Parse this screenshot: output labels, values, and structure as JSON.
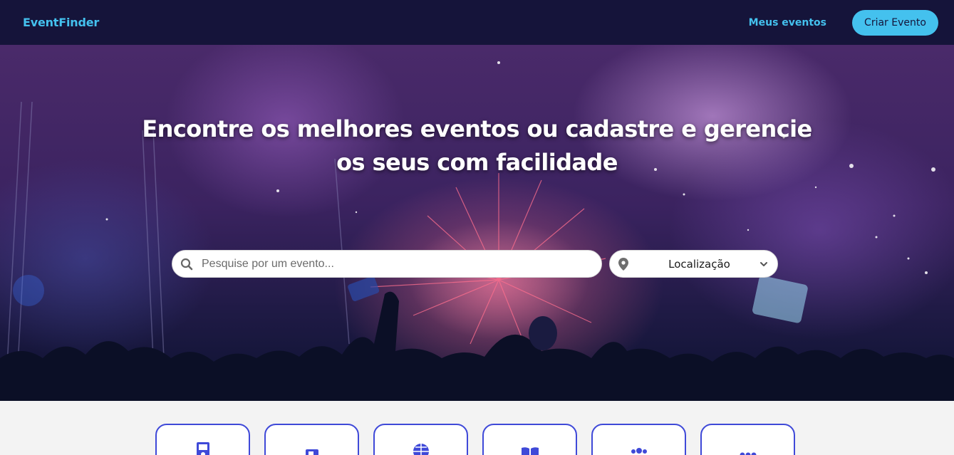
{
  "header": {
    "brand": "EventFinder",
    "nav_my_events": "Meus eventos",
    "create_event": "Criar Evento"
  },
  "hero": {
    "title_line1": "Encontre os melhores eventos ou cadastre e gerencie",
    "title_line2": "os seus com facilidade",
    "search": {
      "placeholder": "Pesquise por um evento...",
      "value": ""
    },
    "location": {
      "label": "Localização"
    }
  },
  "categories": [
    {
      "icon": "music-player-icon"
    },
    {
      "icon": "music-note-icon"
    },
    {
      "icon": "globe-icon"
    },
    {
      "icon": "book-icon"
    },
    {
      "icon": "users-icon"
    },
    {
      "icon": "more-icon"
    }
  ],
  "colors": {
    "header_bg": "#15143a",
    "accent": "#44c1ee",
    "category_border": "#3f49d8",
    "page_bg": "#f3f3f3"
  }
}
